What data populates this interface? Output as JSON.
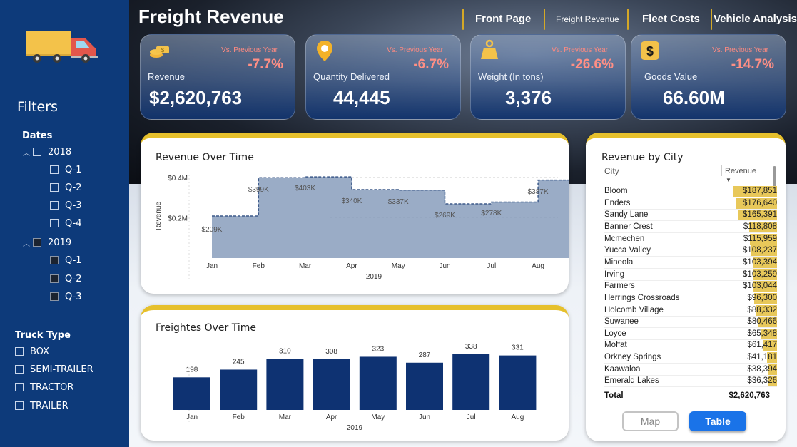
{
  "page_title": "Freight Revenue",
  "nav": [
    "Front Page",
    "Freight Revenue",
    "Fleet Costs",
    "Vehicle Analysis"
  ],
  "sidebar": {
    "filters_title": "Filters",
    "dates_label": "Dates",
    "years": [
      {
        "label": "2018",
        "quarters": [
          "Q-1",
          "Q-2",
          "Q-3",
          "Q-4"
        ]
      },
      {
        "label": "2019",
        "quarters": [
          "Q-1",
          "Q-2",
          "Q-3"
        ]
      }
    ],
    "truck_type_label": "Truck Type",
    "truck_types": [
      "BOX",
      "SEMI-TRAILER",
      "TRACTOR",
      "TRAILER"
    ]
  },
  "kpis": [
    {
      "label": "Revenue",
      "value": "$2,620,763",
      "vs": "Vs. Previous Year",
      "pct": "-7.7%"
    },
    {
      "label": "Quantity Delivered",
      "value": "44,445",
      "vs": "Vs. Previous Year",
      "pct": "-6.7%"
    },
    {
      "label": "Weight (In tons)",
      "value": "3,376",
      "vs": "Vs. Previous Year",
      "pct": "-26.6%"
    },
    {
      "label": "Goods Value",
      "value": "66.60M",
      "vs": "Vs. Previous Year",
      "pct": "-14.7%"
    }
  ],
  "chart_data": [
    {
      "type": "area",
      "title": "Revenue Over Time",
      "ylabel": "Revenue",
      "xlabel": "2019",
      "categories": [
        "Jan",
        "Feb",
        "Mar",
        "Apr",
        "May",
        "Jun",
        "Jul",
        "Aug"
      ],
      "values": [
        209,
        399,
        403,
        340,
        337,
        269,
        278,
        387
      ],
      "labels": [
        "$209K",
        "$399K",
        "$403K",
        "$340K",
        "$337K",
        "$269K",
        "$278K",
        "$387K"
      ],
      "yticks": [
        "$0.2M",
        "$0.4M"
      ],
      "ylim": [
        0,
        400
      ],
      "color": "#8fa3c0"
    },
    {
      "type": "bar",
      "title": "Freightes Over Time",
      "xlabel": "2019",
      "categories": [
        "Jan",
        "Feb",
        "Mar",
        "Apr",
        "May",
        "Jun",
        "Jul",
        "Aug"
      ],
      "values": [
        198,
        245,
        310,
        308,
        323,
        287,
        338,
        331
      ],
      "color": "#0e3272"
    }
  ],
  "city_table": {
    "title": "Revenue by City",
    "col_city": "City",
    "col_revenue": "Revenue",
    "rows": [
      {
        "city": "Bloom",
        "revenue": "$187,851",
        "value": 187851
      },
      {
        "city": "Enders",
        "revenue": "$176,640",
        "value": 176640
      },
      {
        "city": "Sandy Lane",
        "revenue": "$165,391",
        "value": 165391
      },
      {
        "city": "Banner Crest",
        "revenue": "$118,808",
        "value": 118808
      },
      {
        "city": "Mcmechen",
        "revenue": "$115,959",
        "value": 115959
      },
      {
        "city": "Yucca Valley",
        "revenue": "$108,237",
        "value": 108237
      },
      {
        "city": "Mineola",
        "revenue": "$103,394",
        "value": 103394
      },
      {
        "city": "Irving",
        "revenue": "$103,259",
        "value": 103259
      },
      {
        "city": "Farmers",
        "revenue": "$103,044",
        "value": 103044
      },
      {
        "city": "Herrings Crossroads",
        "revenue": "$96,300",
        "value": 96300
      },
      {
        "city": "Holcomb Village",
        "revenue": "$88,332",
        "value": 88332
      },
      {
        "city": "Suwanee",
        "revenue": "$80,466",
        "value": 80466
      },
      {
        "city": "Loyce",
        "revenue": "$65,348",
        "value": 65348
      },
      {
        "city": "Moffat",
        "revenue": "$61,417",
        "value": 61417
      },
      {
        "city": "Orkney Springs",
        "revenue": "$41,181",
        "value": 41181
      },
      {
        "city": "Kaawaloa",
        "revenue": "$38,394",
        "value": 38394
      },
      {
        "city": "Emerald Lakes",
        "revenue": "$36,326",
        "value": 36326
      }
    ],
    "total_label": "Total",
    "total_value": "$2,620,763"
  },
  "view_toggle": {
    "map_label": "Map",
    "table_label": "Table"
  },
  "colors": {
    "sidebar": "#0d3a7a",
    "accent": "#e6c02c",
    "negative": "#ff8f85",
    "bar_navy": "#0e3272",
    "table_bar": "#e8c85a",
    "button_blue": "#1a73e8"
  }
}
